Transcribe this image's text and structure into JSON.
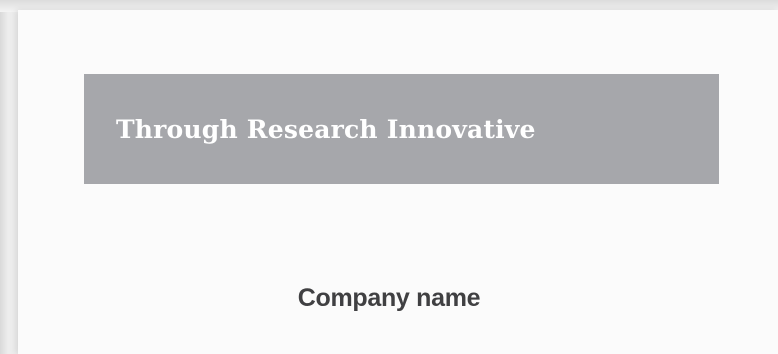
{
  "banner": {
    "text": "Through Research Innovative",
    "background_color": "#a6a7ab",
    "text_color": "#ffffff"
  },
  "footer": {
    "company_name": "Company name",
    "text_color": "#404042"
  },
  "page": {
    "background_color": "#fbfbfb"
  }
}
